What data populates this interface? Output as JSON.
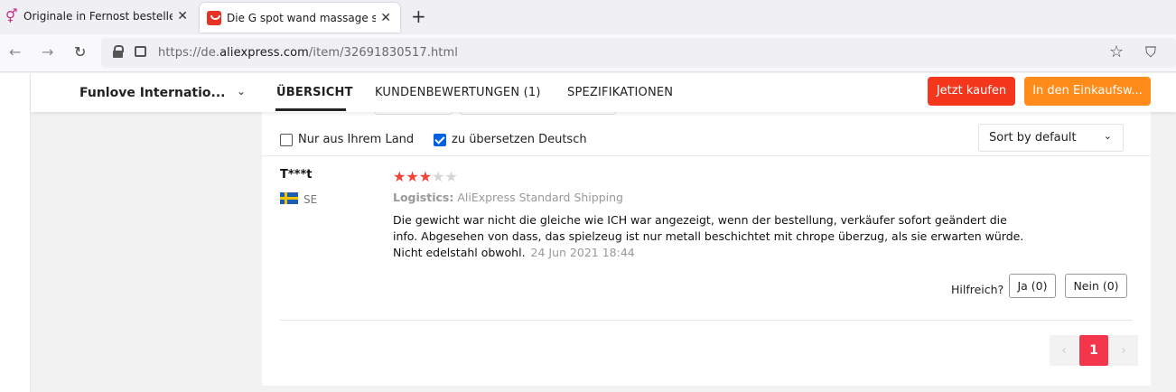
{
  "browser": {
    "tabs": [
      {
        "title": "Originale in Fernost bestellen - A",
        "active": false
      },
      {
        "title": "Die G spot wand massage stick /",
        "active": true
      }
    ],
    "url_prefix": "https://de.",
    "url_domain": "aliexpress.com",
    "url_path": "/item/32691830517.html"
  },
  "header": {
    "store_name": "Funlove Internatio...",
    "tabs": [
      "ÜBERSICHT",
      "KUNDENBEWERTUNGEN (1)",
      "SPEZIFIKATIONEN"
    ],
    "buy_now": "Jetzt kaufen",
    "add_to_cart": "In den Einkaufsw..."
  },
  "filters": {
    "own_country_label": "Nur aus Ihrem Land",
    "translate_label": "zu übersetzen Deutsch",
    "sort_label": "Sort by default"
  },
  "review": {
    "reviewer": "T***t",
    "country": "SE",
    "rating": 3,
    "rating_max": 5,
    "logistics_label": "Logistics:",
    "logistics_value": "AliExpress Standard Shipping",
    "text": "Die gewicht war nicht die gleiche wie ICH war angezeigt, wenn der bestellung, verkäufer sofort geändert die info. Abgesehen von dass, das spielzeug ist nur metall beschichtet mit chrope überzug, als sie erwarten würde. Nicht edelstahl obwohl.",
    "date": "24 Jun 2021 18:44",
    "helpful_label": "Hilfreich?",
    "yes_label": "Ja (0)",
    "no_label": "Nein (0)"
  },
  "pagination": {
    "prev": "‹",
    "current": "1",
    "next": "›"
  },
  "colors": {
    "buy_now": "#f4361d",
    "add_to_cart": "#ff8b1a",
    "star_on": "#f44336",
    "current_page": "#f4364c"
  }
}
